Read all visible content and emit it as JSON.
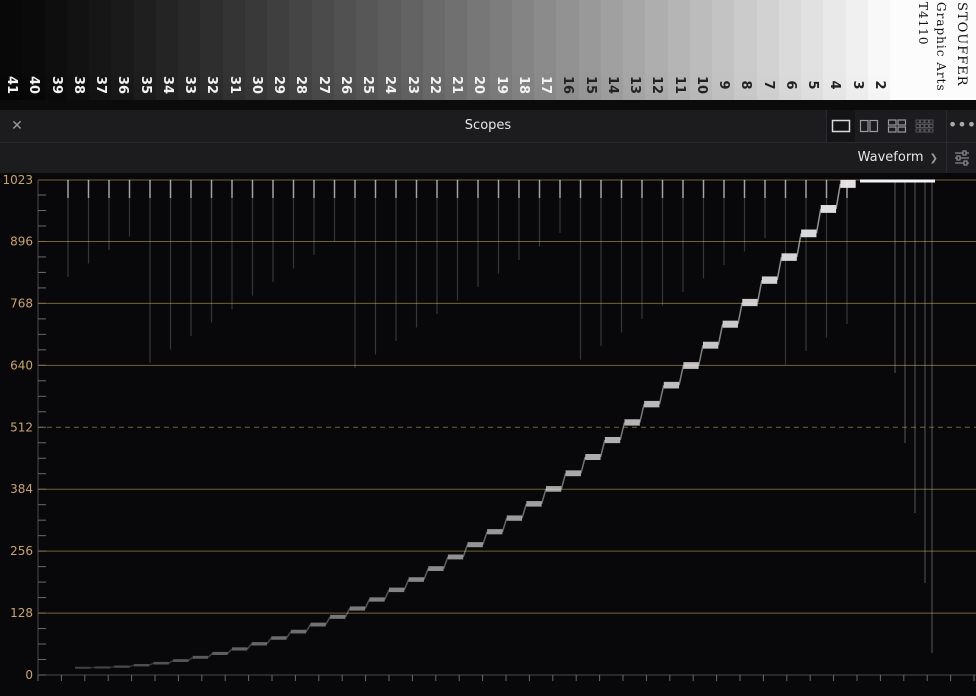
{
  "wedge": {
    "step_numbers": [
      "41",
      "40",
      "39",
      "38",
      "37",
      "36",
      "35",
      "34",
      "33",
      "32",
      "31",
      "30",
      "29",
      "28",
      "27",
      "26",
      "25",
      "24",
      "23",
      "22",
      "21",
      "20",
      "19",
      "18",
      "17",
      "16",
      "15",
      "14",
      "13",
      "12",
      "11",
      "10",
      "9",
      "8",
      "7",
      "6",
      "5",
      "4",
      "3",
      "2"
    ],
    "brand_line1": "STOUFFER",
    "brand_line2": "Graphic Arts",
    "brand_line3": "T4110"
  },
  "header": {
    "close_icon": "close-icon",
    "title": "Scopes",
    "layouts": [
      "single-view-icon",
      "two-up-view-icon",
      "quad-view-icon",
      "grid-view-icon"
    ],
    "more_icon": "more-options-icon"
  },
  "toolbar": {
    "mode": "Waveform",
    "settings_icon": "sliders-icon"
  },
  "scope": {
    "y_ticks": [
      "1023",
      "896",
      "768",
      "640",
      "512",
      "384",
      "256",
      "128",
      "0"
    ],
    "grid_color": "#8a6f3e",
    "label_color": "#c9a46a"
  },
  "colors": {
    "panel_bg": "#1c1c1f",
    "scope_bg": "#08080a"
  }
}
